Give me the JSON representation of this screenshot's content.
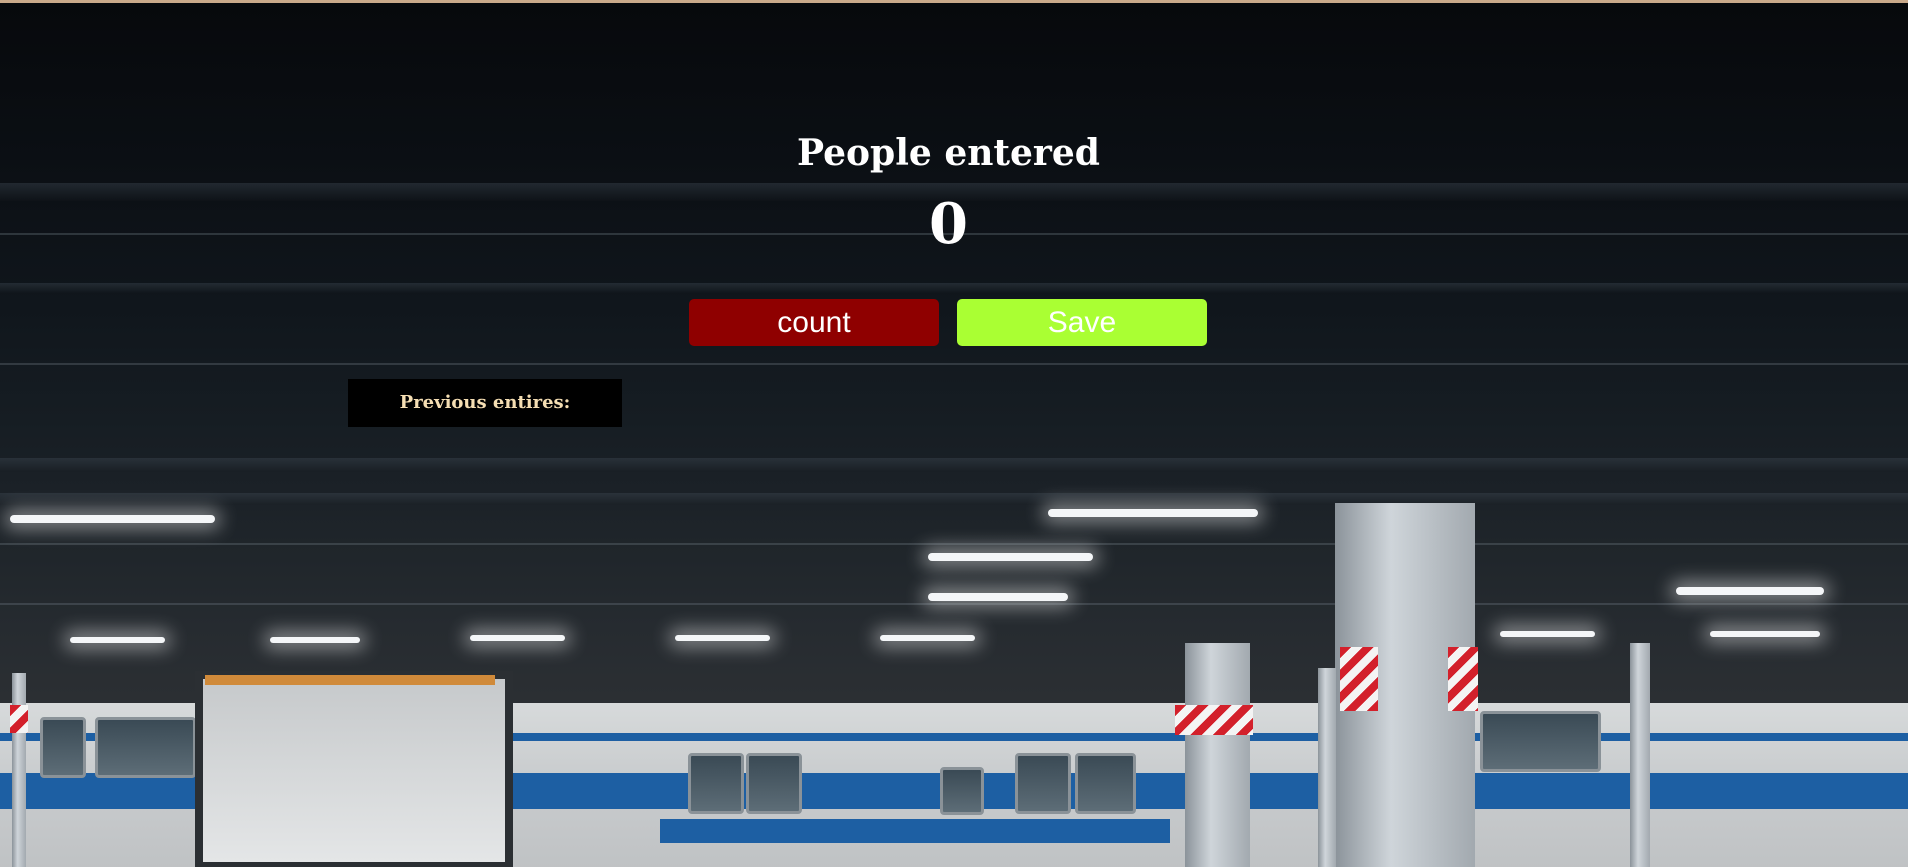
{
  "counter": {
    "title": "People entered",
    "value": "0"
  },
  "buttons": {
    "count_label": "count",
    "save_label": "Save"
  },
  "previous": {
    "label": "Previous entires:"
  },
  "colors": {
    "count_button": "#8f0000",
    "save_button": "#aaff33",
    "previous_box_bg": "#000000",
    "previous_text": "#f5deb3",
    "title_text": "#ffffff"
  },
  "background": {
    "description_icon": "train-station-background"
  }
}
